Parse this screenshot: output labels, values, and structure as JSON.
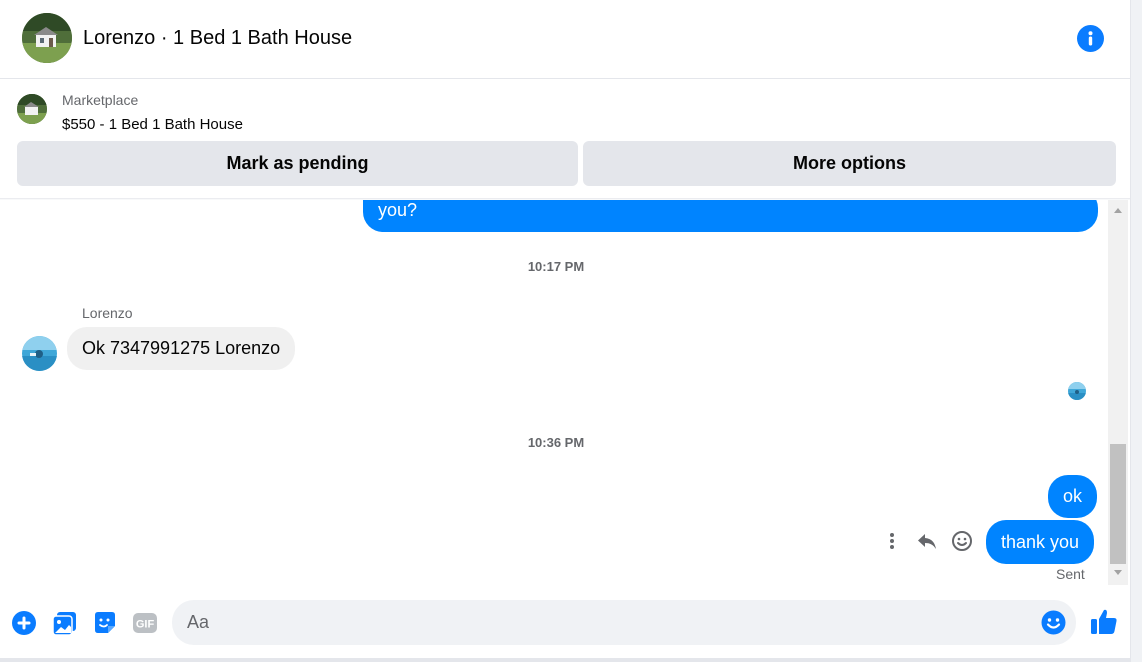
{
  "header": {
    "title": "Lorenzo · 1 Bed 1 Bath House",
    "avatar_icon": "house-photo-avatar",
    "info_icon": "info-icon"
  },
  "marketplace": {
    "label": "Marketplace",
    "listing": "$550 - 1 Bed 1 Bath House",
    "mark_pending_label": "Mark as pending",
    "more_options_label": "More options"
  },
  "messages": {
    "partial_outgoing": "you?",
    "timestamp_1": "10:17 PM",
    "sender_name": "Lorenzo",
    "incoming_1": "Ok 7347991275 Lorenzo",
    "timestamp_2": "10:36 PM",
    "outgoing_1": "ok",
    "outgoing_2": "thank you",
    "status": "Sent"
  },
  "composer": {
    "placeholder": "Aa",
    "value": ""
  },
  "colors": {
    "accent": "#0084ff",
    "icon_blue": "#0a7cff",
    "incoming_bubble": "#f0f0f0",
    "button_gray": "#e4e6eb",
    "secondary_text": "#65676b"
  }
}
